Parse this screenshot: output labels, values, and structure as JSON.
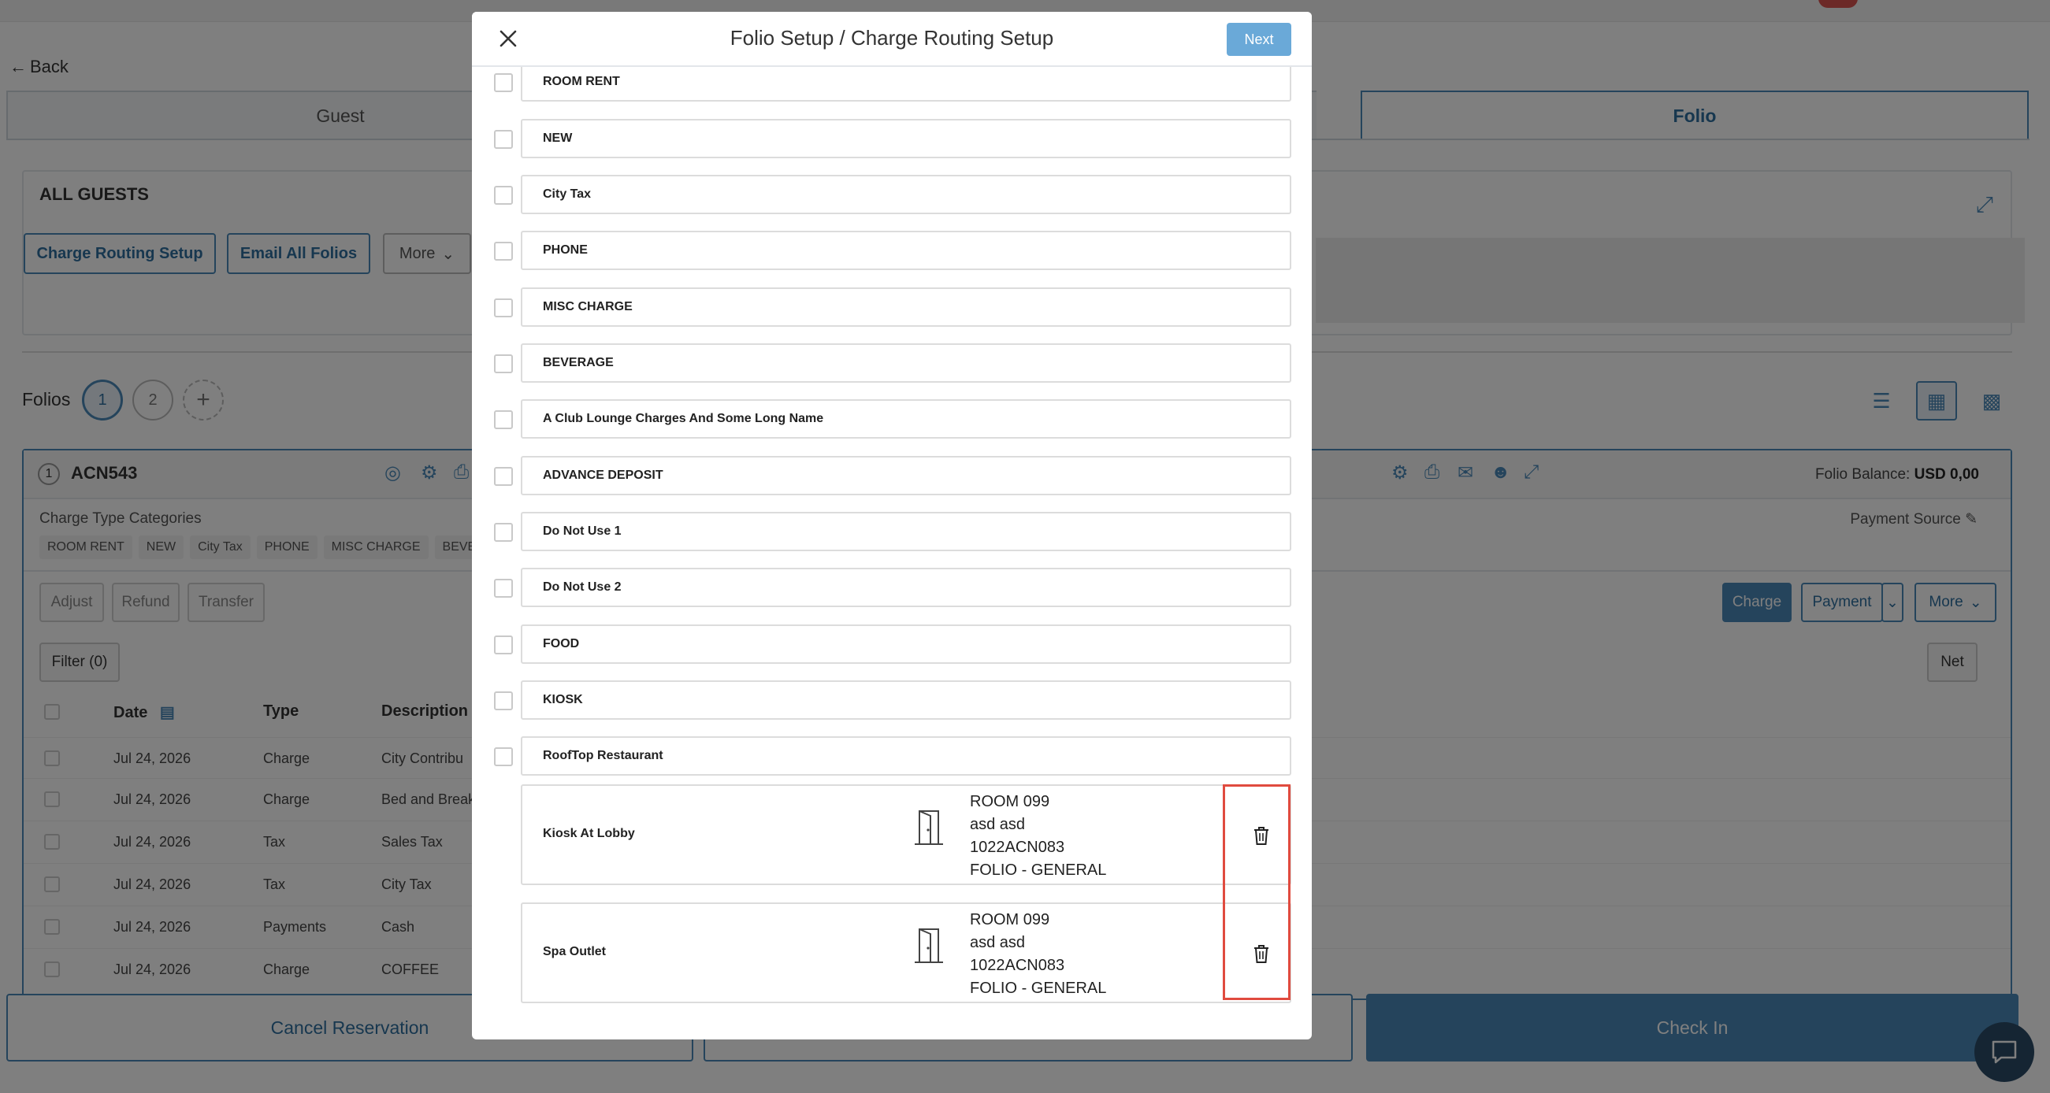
{
  "background": {
    "back_label": "Back",
    "tabs": [
      "Guest",
      "Folio"
    ],
    "panel_title": "ALL GUESTS",
    "panel_buttons": [
      "Charge Routing Setup",
      "Email All Folios",
      "More"
    ],
    "folios_label": "Folios",
    "folio_numbers": [
      "1",
      "2"
    ],
    "folio_card": {
      "number": "1",
      "name": "ACN543",
      "balance_label": "Folio Balance:",
      "balance_value": "USD 0,00",
      "categories_label": "Charge Type Categories",
      "chips": [
        "ROOM RENT",
        "NEW",
        "City Tax",
        "PHONE",
        "MISC CHARGE",
        "BEVER"
      ],
      "payment_source_label": "Payment Source",
      "left_buttons": [
        "Adjust",
        "Refund",
        "Transfer"
      ],
      "right_buttons": [
        "Charge",
        "Payment",
        "More"
      ],
      "filter_label": "Filter (0)",
      "net_label": "Net",
      "columns": [
        "Date",
        "Type",
        "Description"
      ],
      "rows": [
        {
          "date": "Jul 24, 2026",
          "type": "Charge",
          "desc": "City Contribu"
        },
        {
          "date": "Jul 24, 2026",
          "type": "Charge",
          "desc": "Bed and Breakfa"
        },
        {
          "date": "Jul 24, 2026",
          "type": "Tax",
          "desc": "Sales Tax"
        },
        {
          "date": "Jul 24, 2026",
          "type": "Tax",
          "desc": "City Tax"
        },
        {
          "date": "Jul 24, 2026",
          "type": "Payments",
          "desc": "Cash"
        },
        {
          "date": "Jul 24, 2026",
          "type": "Charge",
          "desc": "COFFEE"
        }
      ]
    },
    "footer_buttons": [
      "Cancel Reservation",
      "",
      "Check In"
    ]
  },
  "modal": {
    "title": "Folio Setup / Charge Routing Setup",
    "next_label": "Next",
    "charge_categories": [
      "ROOM RENT",
      "NEW",
      "City Tax",
      "PHONE",
      "MISC CHARGE",
      "BEVERAGE",
      "A Club Lounge Charges And Some Long Name",
      "ADVANCE DEPOSIT",
      "Do Not Use 1",
      "Do Not Use 2",
      "FOOD",
      "KIOSK",
      "RoofTop Restaurant"
    ],
    "routes": [
      {
        "outlet": "Kiosk At Lobby",
        "room": "ROOM 099",
        "guest": "asd asd",
        "confirmation": "1022ACN083",
        "folio": "FOLIO - GENERAL"
      },
      {
        "outlet": "Spa Outlet",
        "room": "ROOM 099",
        "guest": "asd asd",
        "confirmation": "1022ACN083",
        "folio": "FOLIO - GENERAL"
      }
    ]
  },
  "colors": {
    "accent": "#4a89b8",
    "next_button": "#6aa9d8",
    "highlight": "#e04b3f",
    "overlay": "rgba(0,0,0,0.5)"
  }
}
